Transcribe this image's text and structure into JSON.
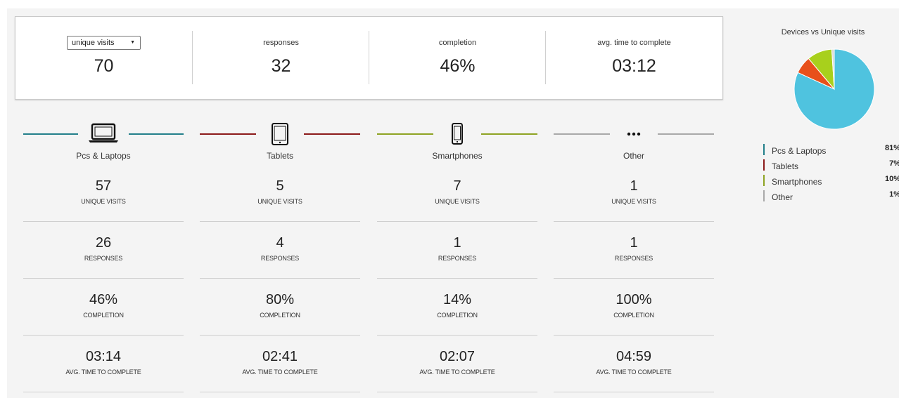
{
  "summary": {
    "metric_select": {
      "selected": "unique visits"
    },
    "unique_visits_value": "70",
    "responses": {
      "label": "responses",
      "value": "32"
    },
    "completion": {
      "label": "completion",
      "value": "46%"
    },
    "avg_time": {
      "label": "avg. time to complete",
      "value": "03:12"
    }
  },
  "stat_captions": {
    "unique_visits": "UNIQUE VISITS",
    "responses": "RESPONSES",
    "completion": "COMPLETION",
    "avg_time": "AVG. TIME TO COMPLETE"
  },
  "devices": [
    {
      "name": "Pcs & Laptops",
      "icon": "laptop-icon",
      "color": "#237f8a",
      "unique_visits": "57",
      "responses": "26",
      "completion": "46%",
      "avg_time": "03:14"
    },
    {
      "name": "Tablets",
      "icon": "tablet-icon",
      "color": "#8b1a1a",
      "unique_visits": "5",
      "responses": "4",
      "completion": "80%",
      "avg_time": "02:41"
    },
    {
      "name": "Smartphones",
      "icon": "smartphone-icon",
      "color": "#8ea323",
      "unique_visits": "7",
      "responses": "1",
      "completion": "14%",
      "avg_time": "02:07"
    },
    {
      "name": "Other",
      "icon": "more-icon",
      "color": "#a9a9a9",
      "unique_visits": "1",
      "responses": "1",
      "completion": "100%",
      "avg_time": "04:59"
    }
  ],
  "chart_data": {
    "type": "pie",
    "title": "Devices vs Unique visits",
    "categories": [
      "Pcs & Laptops",
      "Tablets",
      "Smartphones",
      "Other"
    ],
    "values": [
      81,
      7,
      10,
      1
    ],
    "labels": [
      "81%",
      "7%",
      "10%",
      "1%"
    ],
    "colors": [
      "#4fc3df",
      "#e8501a",
      "#a8d01c",
      "#d8d8d8"
    ],
    "legend_colors": [
      "#237f8a",
      "#8b1a1a",
      "#8ea323",
      "#a9a9a9"
    ],
    "legend": "bottom"
  }
}
